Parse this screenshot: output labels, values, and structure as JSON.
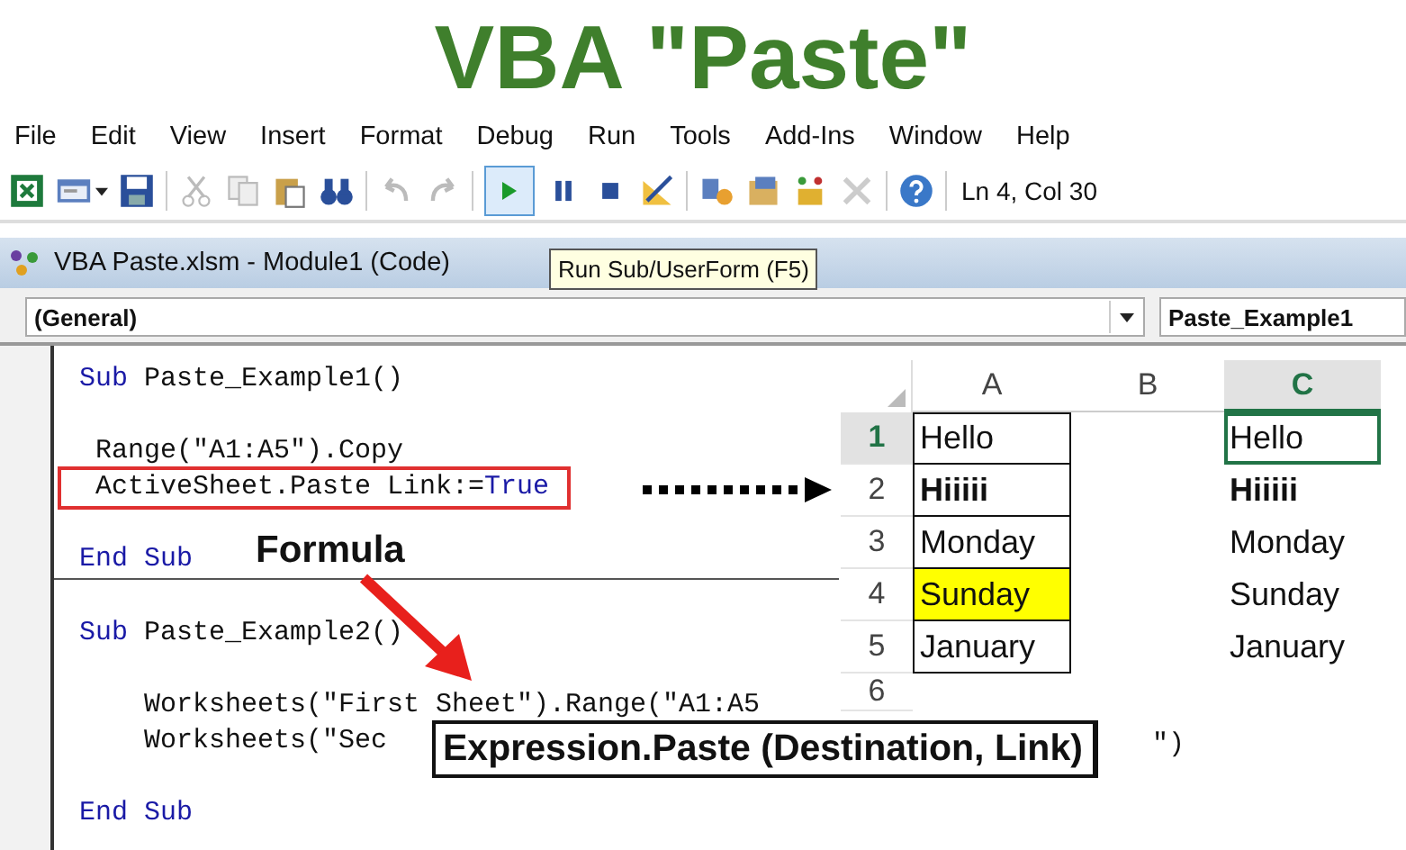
{
  "title": "VBA \"Paste\"",
  "menu": [
    "File",
    "Edit",
    "View",
    "Insert",
    "Format",
    "Debug",
    "Run",
    "Tools",
    "Add-Ins",
    "Window",
    "Help"
  ],
  "toolbar": {
    "run_selected": true,
    "position": "Ln 4, Col 30"
  },
  "code_window": {
    "title": "VBA Paste.xlsm - Module1 (Code)",
    "tooltip": "Run Sub/UserForm (F5)",
    "object_box": "(General)",
    "procedure_box": "Paste_Example1",
    "procedures": [
      {
        "lines": [
          {
            "kind": "code",
            "highlighted": false,
            "segments": [
              {
                "text": "Sub",
                "kind": "keyword"
              },
              {
                "text": " Paste_Example1()",
                "kind": "plain"
              }
            ]
          },
          {
            "kind": "blank"
          },
          {
            "kind": "code",
            "highlighted": false,
            "segments": [
              {
                "text": " Range(\"A1:A5\").Copy",
                "kind": "plain"
              }
            ]
          },
          {
            "kind": "code",
            "highlighted": true,
            "segments": [
              {
                "text": " ActiveSheet.Paste Link:=",
                "kind": "plain"
              },
              {
                "text": "True",
                "kind": "keyword"
              }
            ]
          },
          {
            "kind": "blank"
          },
          {
            "kind": "code",
            "highlighted": false,
            "segments": [
              {
                "text": "End Sub",
                "kind": "keyword"
              }
            ]
          }
        ]
      },
      {
        "lines": [
          {
            "kind": "code",
            "highlighted": false,
            "segments": [
              {
                "text": "Sub",
                "kind": "keyword"
              },
              {
                "text": " Paste_Example2()",
                "kind": "plain"
              }
            ]
          },
          {
            "kind": "blank"
          },
          {
            "kind": "code",
            "highlighted": false,
            "segments": [
              {
                "text": "    Worksheets(\"First Sheet\").Range(\"A1:A5",
                "kind": "plain"
              }
            ]
          },
          {
            "kind": "code",
            "highlighted": false,
            "segments": [
              {
                "text": "    Worksheets(\"Sec",
                "kind": "plain"
              }
            ]
          },
          {
            "kind": "blank"
          },
          {
            "kind": "code",
            "highlighted": false,
            "segments": [
              {
                "text": "End Sub",
                "kind": "keyword"
              }
            ]
          }
        ]
      }
    ]
  },
  "spreadsheet": {
    "columns": [
      {
        "label": "A",
        "selected": false
      },
      {
        "label": "B",
        "selected": false
      },
      {
        "label": "C",
        "selected": true
      }
    ],
    "rows": [
      {
        "header": "1",
        "selected": true,
        "column_a": {
          "text": "Hello",
          "bold": false,
          "highlighted": false
        },
        "column_c": {
          "text": "Hello",
          "bold": false,
          "selected": true
        }
      },
      {
        "header": "2",
        "selected": false,
        "column_a": {
          "text": "Hiiiii",
          "bold": true,
          "highlighted": false
        },
        "column_c": {
          "text": "Hiiiii",
          "bold": true,
          "selected": false
        }
      },
      {
        "header": "3",
        "selected": false,
        "column_a": {
          "text": "Monday",
          "bold": false,
          "highlighted": false
        },
        "column_c": {
          "text": "Monday",
          "bold": false,
          "selected": false
        }
      },
      {
        "header": "4",
        "selected": false,
        "column_a": {
          "text": "Sunday",
          "bold": false,
          "highlighted": true
        },
        "column_c": {
          "text": "Sunday",
          "bold": false,
          "selected": false
        }
      },
      {
        "header": "5",
        "selected": false,
        "column_a": {
          "text": "January",
          "bold": false,
          "highlighted": false
        },
        "column_c": {
          "text": "January",
          "bold": false,
          "selected": false
        }
      },
      {
        "header": "6",
        "selected": false
      }
    ]
  },
  "annotations": {
    "formula_label": "Formula",
    "expression": "Expression.Paste (Destination, Link)",
    "trailing_code": "\")"
  }
}
